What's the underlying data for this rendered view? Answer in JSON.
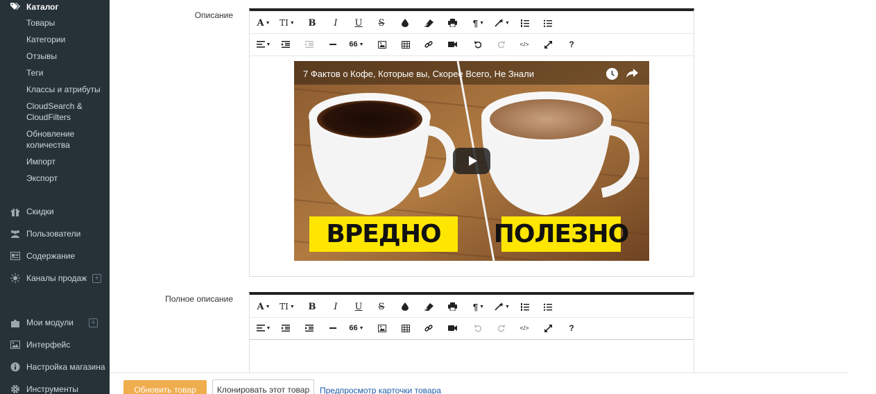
{
  "sidebar": {
    "catalog": {
      "label": "Каталог",
      "icon": "tags-icon"
    },
    "catalog_items": [
      {
        "label": "Товары"
      },
      {
        "label": "Категории"
      },
      {
        "label": "Отзывы"
      },
      {
        "label": "Теги"
      },
      {
        "label": "Классы и атрибуты"
      },
      {
        "label": "CloudSearch & CloudFilters"
      },
      {
        "label": "Обновление количества"
      },
      {
        "label": "Импорт"
      },
      {
        "label": "Экспорт"
      }
    ],
    "main_items": [
      {
        "label": "Скидки",
        "icon": "gift-icon"
      },
      {
        "label": "Пользователи",
        "icon": "users-icon"
      },
      {
        "label": "Содержание",
        "icon": "content-icon"
      },
      {
        "label": "Каналы продаж",
        "icon": "sun-icon"
      },
      {
        "label": "Мои модули",
        "icon": "puzzle-icon"
      },
      {
        "label": "Интерфейс",
        "icon": "image-icon"
      },
      {
        "label": "Настройка магазина",
        "icon": "info-icon"
      },
      {
        "label": "Инструменты",
        "icon": "gear-icon"
      }
    ]
  },
  "fields": {
    "description_label": "Описание",
    "full_description_label": "Полное описание"
  },
  "video": {
    "title": "7 Фактов о Кофе, Которые вы, Скорее Всего, Не Знали",
    "caption_left": "ВРЕДНО",
    "caption_right": "ПОЛЕЗНО"
  },
  "toolbar": {
    "font_letter": "A",
    "size_letters": "TI",
    "bold": "B",
    "italic": "I",
    "underline": "U",
    "strike": "S",
    "paragraph": "¶",
    "help": "?",
    "quote": "66",
    "code": "</>"
  },
  "actions": {
    "update": "Обновить товар",
    "clone": "Клонировать этот товар",
    "preview": "Предпросмотр карточки товара"
  },
  "colors": {
    "sidebar_bg": "#263238",
    "primary_button": "#f0ad4e",
    "caption_yellow": "#ffe600",
    "link": "#1e5ba8"
  }
}
